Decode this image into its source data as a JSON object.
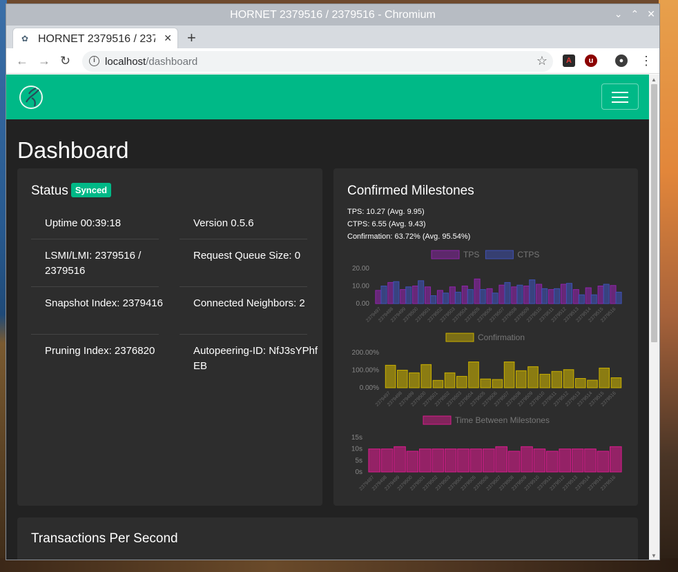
{
  "window": {
    "title": "HORNET 2379516 / 2379516 - Chromium"
  },
  "browser": {
    "tab_title": "HORNET 2379516 / 2379516",
    "url_host": "localhost",
    "url_path": "/dashboard"
  },
  "page": {
    "title": "Dashboard",
    "status": {
      "heading": "Status",
      "badge": "Synced",
      "items": [
        {
          "label": "Uptime 00:39:18"
        },
        {
          "label": "Version 0.5.6"
        },
        {
          "label": "LSMI/LMI: 2379516 / 2379516"
        },
        {
          "label": "Request Queue Size: 0"
        },
        {
          "label": "Snapshot Index: 2379416"
        },
        {
          "label": "Connected Neighbors: 2"
        },
        {
          "label": "Pruning Index: 2376820"
        },
        {
          "label": "Autopeering-ID: NfJ3sYPhfEB"
        }
      ]
    },
    "milestones": {
      "heading": "Confirmed Milestones",
      "tps_line": "TPS: 10.27 (Avg. 9.95)",
      "ctps_line": "CTPS: 6.55 (Avg. 9.43)",
      "confirmation_line": "Confirmation: 63.72% (Avg. 95.54%)"
    },
    "tps_card": {
      "heading": "Transactions Per Second"
    }
  },
  "chart_data": [
    {
      "type": "bar",
      "categories": [
        "2379497",
        "2379498",
        "2379499",
        "2379500",
        "2379501",
        "2379502",
        "2379503",
        "2379504",
        "2379505",
        "2379506",
        "2379507",
        "2379508",
        "2379509",
        "2379510",
        "2379511",
        "2379512",
        "2379513",
        "2379514",
        "2379515",
        "2379516"
      ],
      "series": [
        {
          "name": "TPS",
          "color": "#8e24aa",
          "values": [
            7.5,
            12,
            8,
            10,
            9.5,
            7.5,
            9.5,
            10,
            14,
            8.5,
            10.5,
            9.5,
            10,
            11,
            8,
            11,
            8,
            9,
            10,
            10.3
          ]
        },
        {
          "name": "CTPS",
          "color": "#3f51b5",
          "values": [
            10,
            12.5,
            9.5,
            13,
            4.5,
            6,
            6.5,
            8,
            8,
            6,
            12,
            10.5,
            13.5,
            8.5,
            8.5,
            11.5,
            5,
            5,
            11,
            6.5
          ]
        }
      ],
      "ylim": [
        0,
        20
      ],
      "yticks": [
        "20.00",
        "10.00",
        "0.00"
      ]
    },
    {
      "type": "bar",
      "categories": [
        "2379497",
        "2379498",
        "2379499",
        "2379500",
        "2379501",
        "2379502",
        "2379503",
        "2379504",
        "2379505",
        "2379506",
        "2379507",
        "2379508",
        "2379509",
        "2379510",
        "2379511",
        "2379512",
        "2379513",
        "2379514",
        "2379515",
        "2379516"
      ],
      "series": [
        {
          "name": "Confirmation",
          "color": "#c9b000",
          "values": [
            128,
            100,
            85,
            132,
            42,
            85,
            65,
            147,
            50,
            47,
            147,
            97,
            120,
            77,
            93,
            103,
            53,
            43,
            112,
            57
          ]
        }
      ],
      "ylim": [
        0,
        200
      ],
      "yticks": [
        "200.00%",
        "100.00%",
        "0.00%"
      ]
    },
    {
      "type": "bar",
      "categories": [
        "2379497",
        "2379498",
        "2379499",
        "2379500",
        "2379501",
        "2379502",
        "2379503",
        "2379504",
        "2379505",
        "2379506",
        "2379507",
        "2379508",
        "2379509",
        "2379510",
        "2379511",
        "2379512",
        "2379513",
        "2379514",
        "2379515",
        "2379516"
      ],
      "series": [
        {
          "name": "Time Between Milestones",
          "color": "#d81b8c",
          "values": [
            10,
            10,
            11,
            9,
            10,
            10,
            10,
            10,
            10,
            10,
            11,
            9,
            11,
            10,
            9,
            10,
            10,
            10,
            9,
            11
          ]
        }
      ],
      "ylim": [
        0,
        15
      ],
      "yticks": [
        "15s",
        "10s",
        "5s",
        "0s"
      ]
    }
  ]
}
